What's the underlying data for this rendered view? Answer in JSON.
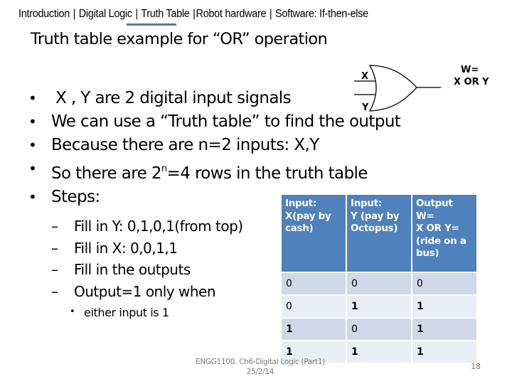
{
  "nav": {
    "items": [
      "Introduction",
      "Digital Logic",
      "Truth Table",
      "Robot hardware",
      "Software: If-then-else"
    ],
    "active": "Truth Table",
    "accent_color": "#5a7898"
  },
  "slide": {
    "title": "Truth table example for “OR” operation",
    "bullets": [
      " X ,  Y are 2 digital input signals",
      "We can use a “Truth table” to find the output",
      "Because there are n=2 inputs: X,Y",
      {
        "pre": "So there are 2",
        "sup": "n",
        "post": "=4 rows in the  truth table"
      },
      "Steps:"
    ],
    "steps": [
      "Fill in Y: 0,1,0,1(from top)",
      "Fill in X: 0,0,1,1",
      "Fill in the outputs",
      "Output=1 only when"
    ],
    "step_detail": "either input is 1"
  },
  "gate": {
    "input_x": "X",
    "input_y": "Y",
    "output_line1": "W=",
    "output_line2": "X OR Y",
    "icon": "or-gate-icon"
  },
  "truth_table": {
    "headers": [
      [
        "Input:",
        "X(pay by",
        "cash)"
      ],
      [
        "Input:",
        "Y (pay by",
        "Octopus)"
      ],
      [
        "Output",
        "W=",
        "X OR Y=",
        "(ride on a",
        "bus)"
      ]
    ],
    "rows": [
      [
        "0",
        "0",
        "0"
      ],
      [
        "0",
        "1",
        "1"
      ],
      [
        "1",
        "0",
        "1"
      ],
      [
        "1",
        "1",
        "1"
      ]
    ],
    "header_color": "#4f81bd",
    "row_colors": [
      "#d0d8e8",
      "#e9edf4"
    ]
  },
  "footer": {
    "course": "ENGG1100. Ch6-Digital Logic (Part1)",
    "date": "25/2/14",
    "page": "18"
  }
}
